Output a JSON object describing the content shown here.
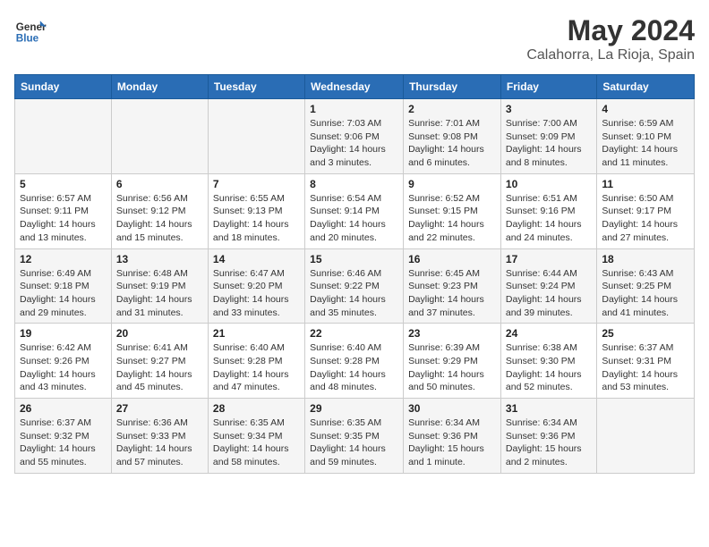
{
  "header": {
    "logo_line1": "General",
    "logo_line2": "Blue",
    "title": "May 2024",
    "subtitle": "Calahorra, La Rioja, Spain"
  },
  "days_of_week": [
    "Sunday",
    "Monday",
    "Tuesday",
    "Wednesday",
    "Thursday",
    "Friday",
    "Saturday"
  ],
  "weeks": [
    [
      {
        "day": "",
        "info": ""
      },
      {
        "day": "",
        "info": ""
      },
      {
        "day": "",
        "info": ""
      },
      {
        "day": "1",
        "info": "Sunrise: 7:03 AM\nSunset: 9:06 PM\nDaylight: 14 hours\nand 3 minutes."
      },
      {
        "day": "2",
        "info": "Sunrise: 7:01 AM\nSunset: 9:08 PM\nDaylight: 14 hours\nand 6 minutes."
      },
      {
        "day": "3",
        "info": "Sunrise: 7:00 AM\nSunset: 9:09 PM\nDaylight: 14 hours\nand 8 minutes."
      },
      {
        "day": "4",
        "info": "Sunrise: 6:59 AM\nSunset: 9:10 PM\nDaylight: 14 hours\nand 11 minutes."
      }
    ],
    [
      {
        "day": "5",
        "info": "Sunrise: 6:57 AM\nSunset: 9:11 PM\nDaylight: 14 hours\nand 13 minutes."
      },
      {
        "day": "6",
        "info": "Sunrise: 6:56 AM\nSunset: 9:12 PM\nDaylight: 14 hours\nand 15 minutes."
      },
      {
        "day": "7",
        "info": "Sunrise: 6:55 AM\nSunset: 9:13 PM\nDaylight: 14 hours\nand 18 minutes."
      },
      {
        "day": "8",
        "info": "Sunrise: 6:54 AM\nSunset: 9:14 PM\nDaylight: 14 hours\nand 20 minutes."
      },
      {
        "day": "9",
        "info": "Sunrise: 6:52 AM\nSunset: 9:15 PM\nDaylight: 14 hours\nand 22 minutes."
      },
      {
        "day": "10",
        "info": "Sunrise: 6:51 AM\nSunset: 9:16 PM\nDaylight: 14 hours\nand 24 minutes."
      },
      {
        "day": "11",
        "info": "Sunrise: 6:50 AM\nSunset: 9:17 PM\nDaylight: 14 hours\nand 27 minutes."
      }
    ],
    [
      {
        "day": "12",
        "info": "Sunrise: 6:49 AM\nSunset: 9:18 PM\nDaylight: 14 hours\nand 29 minutes."
      },
      {
        "day": "13",
        "info": "Sunrise: 6:48 AM\nSunset: 9:19 PM\nDaylight: 14 hours\nand 31 minutes."
      },
      {
        "day": "14",
        "info": "Sunrise: 6:47 AM\nSunset: 9:20 PM\nDaylight: 14 hours\nand 33 minutes."
      },
      {
        "day": "15",
        "info": "Sunrise: 6:46 AM\nSunset: 9:22 PM\nDaylight: 14 hours\nand 35 minutes."
      },
      {
        "day": "16",
        "info": "Sunrise: 6:45 AM\nSunset: 9:23 PM\nDaylight: 14 hours\nand 37 minutes."
      },
      {
        "day": "17",
        "info": "Sunrise: 6:44 AM\nSunset: 9:24 PM\nDaylight: 14 hours\nand 39 minutes."
      },
      {
        "day": "18",
        "info": "Sunrise: 6:43 AM\nSunset: 9:25 PM\nDaylight: 14 hours\nand 41 minutes."
      }
    ],
    [
      {
        "day": "19",
        "info": "Sunrise: 6:42 AM\nSunset: 9:26 PM\nDaylight: 14 hours\nand 43 minutes."
      },
      {
        "day": "20",
        "info": "Sunrise: 6:41 AM\nSunset: 9:27 PM\nDaylight: 14 hours\nand 45 minutes."
      },
      {
        "day": "21",
        "info": "Sunrise: 6:40 AM\nSunset: 9:28 PM\nDaylight: 14 hours\nand 47 minutes."
      },
      {
        "day": "22",
        "info": "Sunrise: 6:40 AM\nSunset: 9:28 PM\nDaylight: 14 hours\nand 48 minutes."
      },
      {
        "day": "23",
        "info": "Sunrise: 6:39 AM\nSunset: 9:29 PM\nDaylight: 14 hours\nand 50 minutes."
      },
      {
        "day": "24",
        "info": "Sunrise: 6:38 AM\nSunset: 9:30 PM\nDaylight: 14 hours\nand 52 minutes."
      },
      {
        "day": "25",
        "info": "Sunrise: 6:37 AM\nSunset: 9:31 PM\nDaylight: 14 hours\nand 53 minutes."
      }
    ],
    [
      {
        "day": "26",
        "info": "Sunrise: 6:37 AM\nSunset: 9:32 PM\nDaylight: 14 hours\nand 55 minutes."
      },
      {
        "day": "27",
        "info": "Sunrise: 6:36 AM\nSunset: 9:33 PM\nDaylight: 14 hours\nand 57 minutes."
      },
      {
        "day": "28",
        "info": "Sunrise: 6:35 AM\nSunset: 9:34 PM\nDaylight: 14 hours\nand 58 minutes."
      },
      {
        "day": "29",
        "info": "Sunrise: 6:35 AM\nSunset: 9:35 PM\nDaylight: 14 hours\nand 59 minutes."
      },
      {
        "day": "30",
        "info": "Sunrise: 6:34 AM\nSunset: 9:36 PM\nDaylight: 15 hours\nand 1 minute."
      },
      {
        "day": "31",
        "info": "Sunrise: 6:34 AM\nSunset: 9:36 PM\nDaylight: 15 hours\nand 2 minutes."
      },
      {
        "day": "",
        "info": ""
      }
    ]
  ]
}
